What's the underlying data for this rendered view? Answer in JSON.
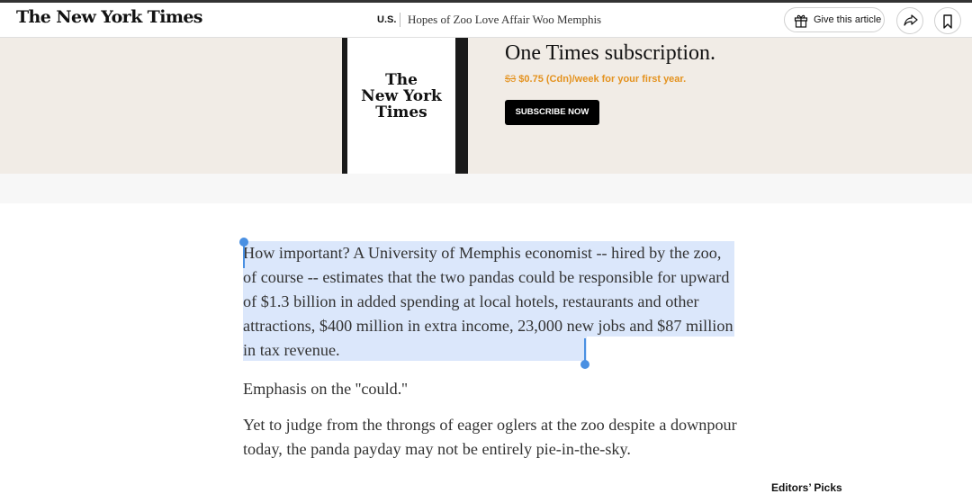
{
  "header": {
    "logo": "The New York Times",
    "section": "U.S.",
    "headline": "Hopes of Zoo Love Affair Woo Memphis",
    "gift_button_label": "Give this article"
  },
  "promo": {
    "title": "One Times subscription.",
    "old_price": "$3",
    "price_text": " $0.75 (Cdn)/week for your first year.",
    "subscribe_label": "SUBSCRIBE NOW",
    "phone_logo": "The New York Times"
  },
  "article": {
    "selected_paragraph": "How important? A University of Memphis economist -- hired by the zoo, of course -- estimates that the two pandas could be responsible for upward of $1.3 billion in added spending at local hotels, restaurants and other attractions, $400 million in extra income, 23,000 new jobs and $87 million in tax revenue.",
    "paragraph_2": "Emphasis on the ''could.''",
    "paragraph_3": "Yet to judge from the throngs of eager oglers at the zoo despite a downpour today, the panda payday may not be entirely pie-in-the-sky."
  },
  "sidebar": {
    "editors_picks": "Editors’ Picks"
  },
  "colors": {
    "selection": "#dbe7fb",
    "selection_handle": "#4a90e2",
    "price_accent": "#e4921e",
    "promo_bg": "#f1ece6"
  },
  "icons": [
    "gift-icon",
    "share-icon",
    "bookmark-icon"
  ]
}
